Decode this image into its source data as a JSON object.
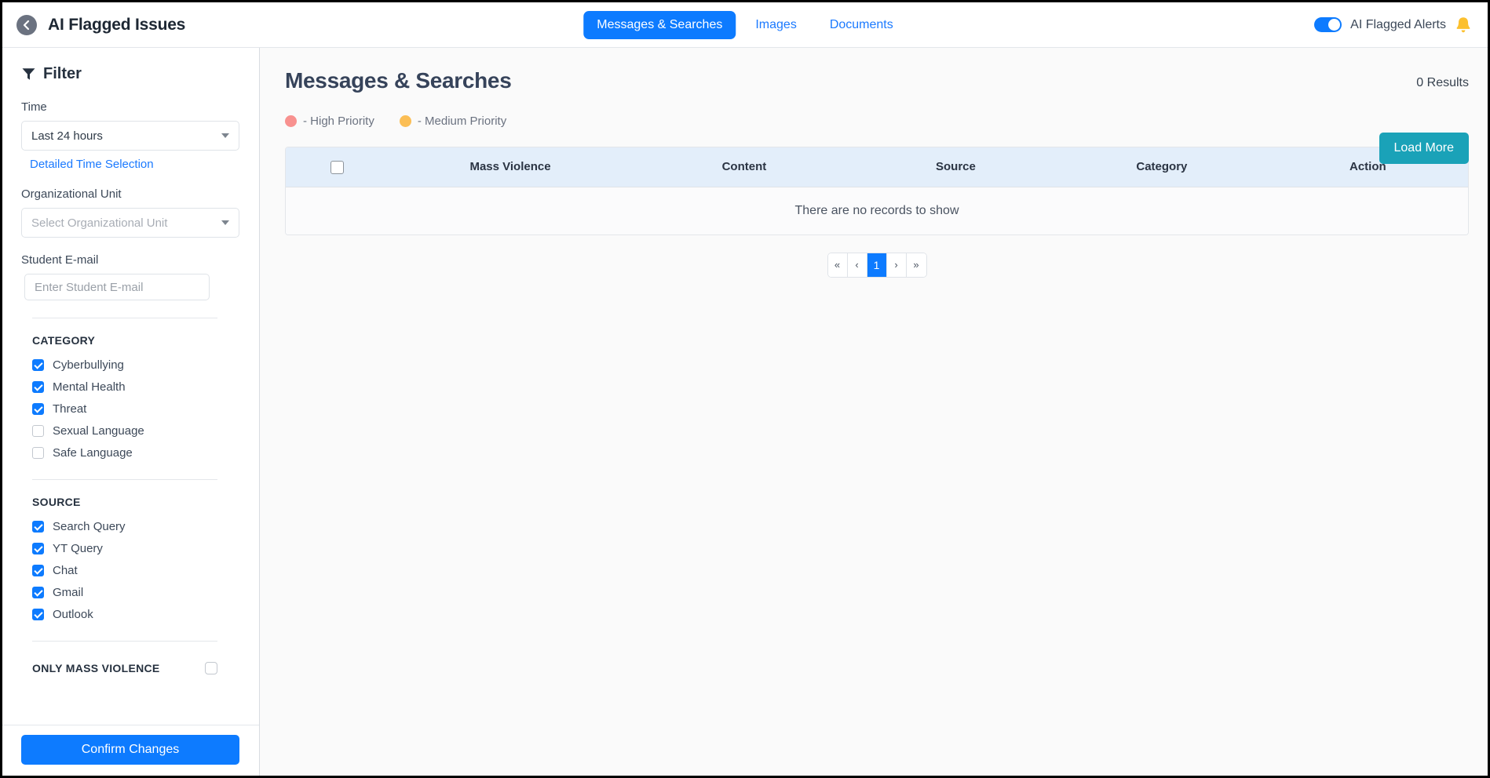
{
  "topbar": {
    "back_icon": "back-arrow-circle-icon",
    "title": "AI Flagged Issues",
    "tabs": [
      {
        "label": "Messages & Searches",
        "active": true
      },
      {
        "label": "Images",
        "active": false
      },
      {
        "label": "Documents",
        "active": false
      }
    ],
    "alerts_toggle": {
      "label": "AI Flagged Alerts",
      "on": true
    },
    "bell_icon": "bell-icon",
    "bell_color": "#fcc02e",
    "active_tab_color": "#0d7bff",
    "link_color": "#1b7aff"
  },
  "sidebar": {
    "filter_icon": "funnel-icon",
    "filter_title": "Filter",
    "time": {
      "label": "Time",
      "value": "Last 24 hours",
      "detailed_link": "Detailed Time Selection"
    },
    "org_unit": {
      "label": "Organizational Unit",
      "placeholder": "Select Organizational Unit",
      "value": ""
    },
    "student_email": {
      "label": "Student E-mail",
      "placeholder": "Enter Student E-mail",
      "value": ""
    },
    "category": {
      "title": "CATEGORY",
      "items": [
        {
          "label": "Cyberbullying",
          "checked": true
        },
        {
          "label": "Mental Health",
          "checked": true
        },
        {
          "label": "Threat",
          "checked": true
        },
        {
          "label": "Sexual Language",
          "checked": false
        },
        {
          "label": "Safe Language",
          "checked": false
        }
      ]
    },
    "source": {
      "title": "SOURCE",
      "items": [
        {
          "label": "Search Query",
          "checked": true
        },
        {
          "label": "YT Query",
          "checked": true
        },
        {
          "label": "Chat",
          "checked": true
        },
        {
          "label": "Gmail",
          "checked": true
        },
        {
          "label": "Outlook",
          "checked": true
        }
      ]
    },
    "only_mass_violence": {
      "title": "ONLY MASS VIOLENCE",
      "checked": false
    },
    "confirm_button": "Confirm Changes"
  },
  "main": {
    "page_title": "Messages & Searches",
    "results_count": "0 Results",
    "load_more": "Load More",
    "legend": [
      {
        "text": "- High Priority",
        "color": "#f8918f"
      },
      {
        "text": "- Medium Priority",
        "color": "#fbbe55"
      }
    ],
    "table": {
      "columns": [
        "",
        "Mass Violence",
        "Content",
        "Source",
        "Category",
        "Action"
      ],
      "header_checkbox": false,
      "empty_message": "There are no records to show",
      "rows": []
    },
    "pagination": {
      "first": "«",
      "prev": "‹",
      "current": "1",
      "next": "›",
      "last": "»"
    }
  }
}
